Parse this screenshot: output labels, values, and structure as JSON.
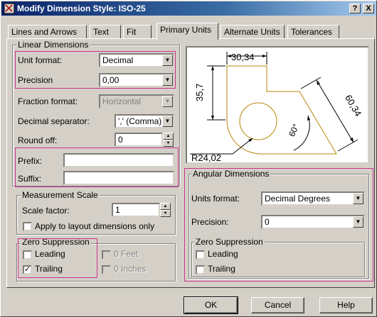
{
  "window": {
    "title": "Modify Dimension Style: ISO-25",
    "help_btn": "?",
    "close_btn": "X"
  },
  "tabs": [
    {
      "label": "Lines and Arrows"
    },
    {
      "label": "Text"
    },
    {
      "label": "Fit"
    },
    {
      "label": "Primary Units"
    },
    {
      "label": "Alternate Units"
    },
    {
      "label": "Tolerances"
    }
  ],
  "active_tab": "Primary Units",
  "linear": {
    "group_label": "Linear Dimensions",
    "unit_format_label": "Unit format:",
    "unit_format_value": "Decimal",
    "precision_label": "Precision",
    "precision_value": "0,00",
    "fraction_format_label": "Fraction format:",
    "fraction_format_value": "Horizontal",
    "decimal_separator_label": "Decimal separator:",
    "decimal_separator_value": "',' (Comma)",
    "round_off_label": "Round off:",
    "round_off_value": "0",
    "prefix_label": "Prefix:",
    "prefix_value": "",
    "suffix_label": "Suffix:",
    "suffix_value": ""
  },
  "measurement": {
    "group_label": "Measurement Scale",
    "scale_factor_label": "Scale factor:",
    "scale_factor_value": "1",
    "apply_layout_label": "Apply to layout dimensions only",
    "apply_layout_checked": false
  },
  "zero_linear": {
    "group_label": "Zero Suppression",
    "leading_label": "Leading",
    "leading_checked": false,
    "trailing_label": "Trailing",
    "trailing_checked": true,
    "feet_label": "0 Feet",
    "inches_label": "0 Inches"
  },
  "preview": {
    "dim_top": "30,34",
    "dim_left": "35,7",
    "dim_right": "60,34",
    "dim_angle": "60°",
    "dim_radius": "R24,02"
  },
  "angular": {
    "group_label": "Angular Dimensions",
    "units_format_label": "Units format:",
    "units_format_value": "Decimal Degrees",
    "precision_label": "Precision:",
    "precision_value": "0",
    "zero_group_label": "Zero Suppression",
    "leading_label": "Leading",
    "leading_checked": false,
    "trailing_label": "Trailing",
    "trailing_checked": false
  },
  "buttons": {
    "ok": "OK",
    "cancel": "Cancel",
    "help": "Help"
  },
  "colors": {
    "highlight": "#d0308a",
    "preview_geometry": "#b8860b",
    "title_bar": "#0a246a"
  }
}
